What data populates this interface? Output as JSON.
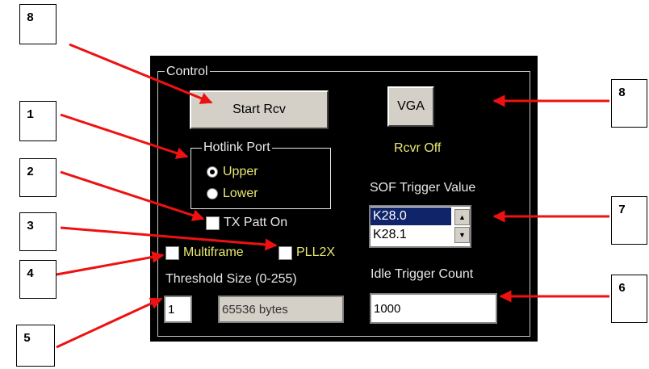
{
  "callouts": [
    "8",
    "1",
    "2",
    "3",
    "4",
    "5",
    "8",
    "7",
    "6"
  ],
  "control": {
    "group_label": "Control",
    "start_button": "Start Rcv",
    "vga_button": "VGA",
    "status": "Rcvr Off",
    "hotlink": {
      "label": "Hotlink Port",
      "upper": "Upper",
      "lower": "Lower",
      "selected": "Upper"
    },
    "tx_patt": "TX Patt On",
    "multiframe": "Multiframe",
    "pll2x": "PLL2X",
    "threshold_label": "Threshold Size (0-255)",
    "threshold_value": "1",
    "threshold_bytes": "65536 bytes",
    "sof_label": "SOF Trigger  Value",
    "sof_options": [
      "K28.0",
      "K28.1"
    ],
    "idle_label": "Idle Trigger Count",
    "idle_value": "1000"
  },
  "colors": {
    "panel": "#000000",
    "label": "#e8e8e8",
    "status": "#e8e870",
    "arrow": "#ee1111",
    "button": "#d4d0c8",
    "selection": "#10246a"
  }
}
